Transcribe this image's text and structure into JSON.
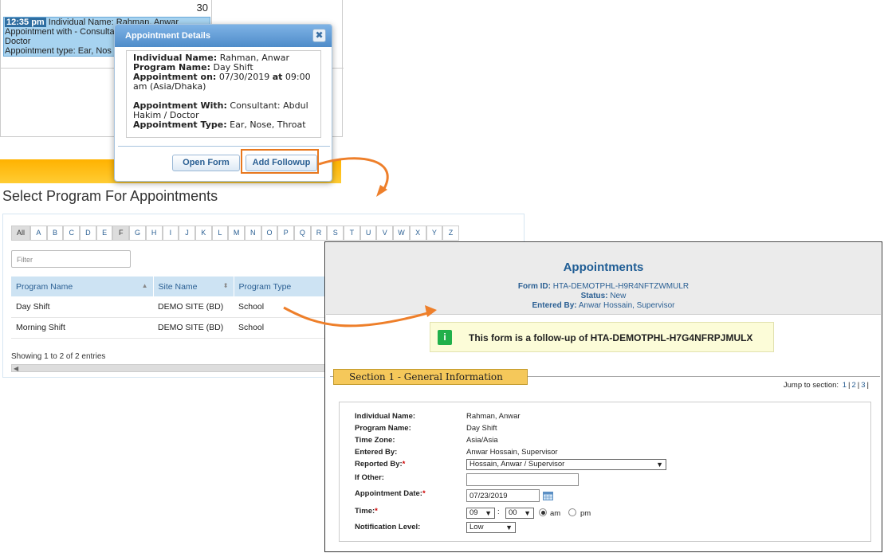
{
  "calendar": {
    "day_number": "30",
    "event": {
      "time": "12:35 pm",
      "line1": "Individual Name: Rahman, Anwar",
      "line2": "Appointment with - Consultant:",
      "line3": "Doctor",
      "line4": "Appointment type: Ear, Nos"
    }
  },
  "popup": {
    "title": "Appointment Details",
    "close_glyph": "✖",
    "individual_name_label": "Individual Name:",
    "individual_name": "Rahman, Anwar",
    "program_name_label": "Program Name:",
    "program_name": "Day Shift",
    "appointment_on_label": "Appointment on:",
    "appointment_on_date": "07/30/2019",
    "at_label": "at",
    "appointment_on_time": "09:00",
    "appointment_on_tz": "am (Asia/Dhaka)",
    "appointment_with_label": "Appointment With:",
    "appointment_with_1": "Consultant: Abdul",
    "appointment_with_2": "Hakim / Doctor",
    "appointment_type_label": "Appointment Type:",
    "appointment_type": "Ear, Nose, Throat",
    "open_form": "Open Form",
    "add_followup": "Add Followup"
  },
  "select_program": {
    "title": "Select Program For Appointments",
    "letters": [
      "All",
      "A",
      "B",
      "C",
      "D",
      "E",
      "F",
      "G",
      "H",
      "I",
      "J",
      "K",
      "L",
      "M",
      "N",
      "O",
      "P",
      "Q",
      "R",
      "S",
      "T",
      "U",
      "V",
      "W",
      "X",
      "Y",
      "Z"
    ],
    "filter_placeholder": "Filter",
    "columns": [
      "Program Name",
      "Site Name",
      "Program Type"
    ],
    "rows": [
      [
        "Day Shift",
        "DEMO SITE (BD)",
        "School"
      ],
      [
        "Morning Shift",
        "DEMO SITE (BD)",
        "School"
      ]
    ],
    "info": "Showing 1 to 2 of 2 entries",
    "scroll_glyph": "◀"
  },
  "form": {
    "title": "Appointments",
    "form_id_label": "Form ID:",
    "form_id": "HTA-DEMOTPHL-H9R4NFTZWMULR",
    "status_label": "Status:",
    "status": "New",
    "entered_by_label": "Entered By:",
    "entered_by": "Anwar Hossain, Supervisor",
    "notice_icon": "i",
    "notice": "This form is a follow-up of HTA-DEMOTPHL-H7G4NFRPJMULX",
    "section_title": "Section 1 - General Information",
    "jump_label": "Jump to section:",
    "jump_links": [
      "1",
      "2",
      "3"
    ],
    "fields": {
      "individual_name_label": "Individual Name:",
      "individual_name": "Rahman, Anwar",
      "program_name_label": "Program Name:",
      "program_name": "Day Shift",
      "time_zone_label": "Time Zone:",
      "time_zone": "Asia/Asia",
      "entered_by_label": "Entered By:",
      "entered_by": "Anwar Hossain, Supervisor",
      "reported_by_label": "Reported By:",
      "reported_by": "Hossain, Anwar / Supervisor",
      "if_other_label": "If Other:",
      "if_other": "",
      "appointment_date_label": "Appointment Date:",
      "appointment_date": "07/23/2019",
      "time_label": "Time:",
      "hour": "09",
      "minute": "00",
      "am": "am",
      "pm": "pm",
      "notification_label": "Notification Level:",
      "notification": "Low"
    }
  }
}
